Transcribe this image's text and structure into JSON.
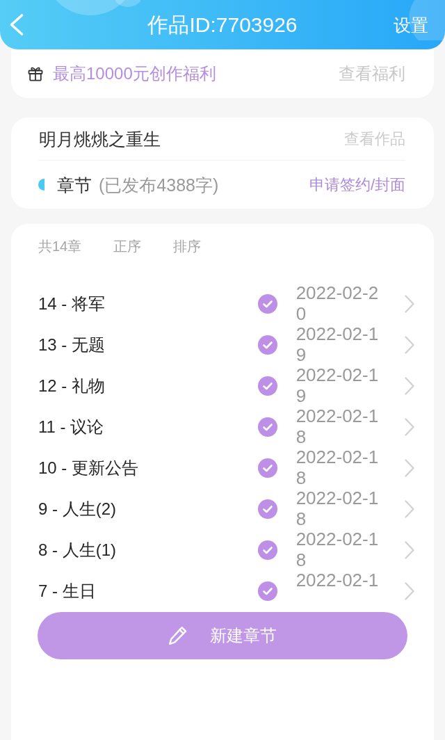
{
  "header": {
    "title": "作品ID:7703926",
    "action": "设置"
  },
  "benefit": {
    "text": "最高10000元创作福利",
    "link": "查看福利"
  },
  "work": {
    "title": "明月烑烑之重生",
    "link": "查看作品",
    "section_label": "章节",
    "section_note": "(已发布4388字)",
    "section_link": "申请签约/封面"
  },
  "chapter_list": {
    "count": "共14章",
    "sort_options": [
      "正序",
      "排序"
    ],
    "chapters": [
      {
        "title": "14 - 将军",
        "published": true,
        "date": "2022-02-20"
      },
      {
        "title": "13 - 无题",
        "published": true,
        "date": "2022-02-19"
      },
      {
        "title": "12 - 礼物",
        "published": true,
        "date": "2022-02-19"
      },
      {
        "title": "11 - 议论",
        "published": true,
        "date": "2022-02-18"
      },
      {
        "title": "10 - 更新公告",
        "published": true,
        "date": "2022-02-18"
      },
      {
        "title": "9 - 人生(2)",
        "published": true,
        "date": "2022-02-18"
      },
      {
        "title": "8 - 人生(1)",
        "published": true,
        "date": "2022-02-18"
      },
      {
        "title": "7 - 生日",
        "published": true,
        "date": "2022-02-1"
      }
    ]
  },
  "new_chapter_button": {
    "label": "新建章节"
  }
}
